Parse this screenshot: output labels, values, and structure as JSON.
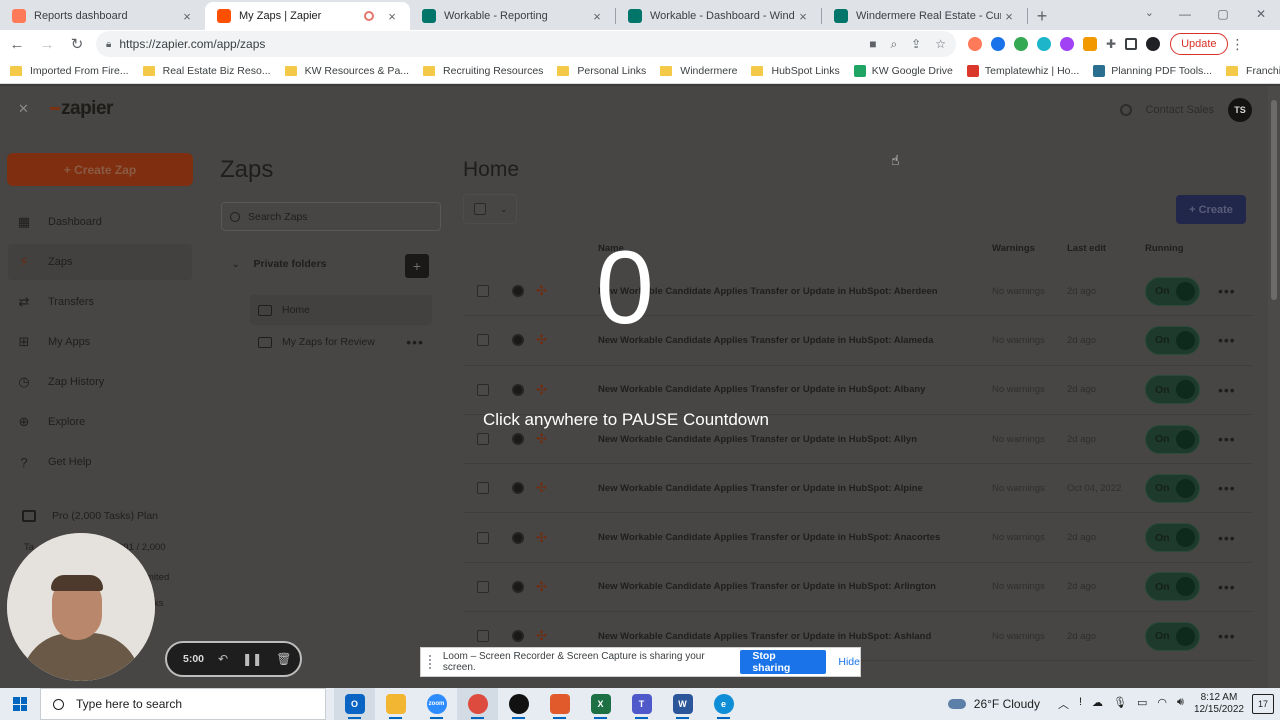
{
  "browser": {
    "tabs": [
      {
        "title": "Reports dashboard",
        "favicon_color": "#ff7a59",
        "active": false
      },
      {
        "title": "My Zaps | Zapier",
        "favicon_color": "#ff4f00",
        "active": true
      },
      {
        "title": "Workable - Reporting",
        "favicon_color": "#00756a",
        "active": false
      },
      {
        "title": "Workable - Dashboard - Windermere",
        "favicon_color": "#00756a",
        "active": false
      },
      {
        "title": "Windermere Real Estate - Current",
        "favicon_color": "#00756a",
        "active": false
      }
    ],
    "close_glyph": "×",
    "new_tab_glyph": "+",
    "url": "https://zapier.com/app/zaps",
    "update_label": "Update",
    "bookmarks": [
      {
        "label": "Imported From Fire...",
        "type": "folder"
      },
      {
        "label": "Real Estate Biz Reso...",
        "type": "folder"
      },
      {
        "label": "KW Resources & Pa...",
        "type": "folder"
      },
      {
        "label": "Recruiting Resources",
        "type": "folder"
      },
      {
        "label": "Personal Links",
        "type": "folder"
      },
      {
        "label": "Windermere",
        "type": "folder"
      },
      {
        "label": "HubSpot Links",
        "type": "folder"
      },
      {
        "label": "KW Google Drive",
        "type": "site",
        "color": "#1fa463"
      },
      {
        "label": "Templatewhiz | Ho...",
        "type": "site",
        "color": "#d9382b"
      },
      {
        "label": "Planning PDF Tools...",
        "type": "site",
        "color": "#2a6f8f"
      },
      {
        "label": "Franchise Info",
        "type": "folder"
      }
    ]
  },
  "zapier": {
    "logo_text": "zapier",
    "contact_sales": "Contact Sales",
    "avatar_initials": "TS",
    "create_zap_label": "+ Create Zap",
    "nav": [
      {
        "label": "Dashboard",
        "icon": "dashboard-icon",
        "glyph": "▦",
        "active": false
      },
      {
        "label": "Zaps",
        "icon": "zap-icon",
        "glyph": "⚡",
        "active": true
      },
      {
        "label": "Transfers",
        "icon": "transfers-icon",
        "glyph": "⇄",
        "active": false
      },
      {
        "label": "My Apps",
        "icon": "apps-icon",
        "glyph": "⊞",
        "active": false
      },
      {
        "label": "Zap History",
        "icon": "history-icon",
        "glyph": "◷",
        "active": false
      },
      {
        "label": "Explore",
        "icon": "globe-icon",
        "glyph": "⊕",
        "active": false
      },
      {
        "label": "Get Help",
        "icon": "help-icon",
        "glyph": "?",
        "active": false
      }
    ],
    "plan_label": "Pro (2,000 Tasks) Plan",
    "plan_tasks_prefix": "Ta",
    "plan_tasks_value": "391 / 2,000",
    "plan_line2": "mited",
    "plan_line3": "ks",
    "zaps_title": "Zaps",
    "search_placeholder": "Search Zaps",
    "private_folders": "Private folders",
    "folders": [
      {
        "label": "Home",
        "active": true
      },
      {
        "label": "My Zaps for Review",
        "active": false
      }
    ],
    "home_title": "Home",
    "create_label": "+ Create",
    "columns": {
      "name": "Name",
      "warnings": "Warnings",
      "last_edit": "Last edit",
      "running": "Running"
    },
    "zaps": [
      {
        "name": "New Workable Candidate Applies Transfer or Update in HubSpot: Aberdeen",
        "warnings": "No warnings",
        "last_edit": "2d ago",
        "status": "On"
      },
      {
        "name": "New Workable Candidate Applies Transfer or Update in HubSpot: Alameda",
        "warnings": "No warnings",
        "last_edit": "2d ago",
        "status": "On"
      },
      {
        "name": "New Workable Candidate Applies Transfer or Update in HubSpot: Albany",
        "warnings": "No warnings",
        "last_edit": "2d ago",
        "status": "On"
      },
      {
        "name": "New Workable Candidate Applies Transfer or Update in HubSpot: Allyn",
        "warnings": "No warnings",
        "last_edit": "2d ago",
        "status": "On"
      },
      {
        "name": "New Workable Candidate Applies Transfer or Update in HubSpot: Alpine",
        "warnings": "No warnings",
        "last_edit": "Oct 04, 2022",
        "status": "On"
      },
      {
        "name": "New Workable Candidate Applies Transfer or Update in HubSpot: Anacortes",
        "warnings": "No warnings",
        "last_edit": "2d ago",
        "status": "On"
      },
      {
        "name": "New Workable Candidate Applies Transfer or Update in HubSpot: Arlington",
        "warnings": "No warnings",
        "last_edit": "2d ago",
        "status": "On"
      },
      {
        "name": "New Workable Candidate Applies Transfer or Update in HubSpot: Ashland",
        "warnings": "No warnings",
        "last_edit": "2d ago",
        "status": "On"
      }
    ]
  },
  "loom": {
    "countdown": "0",
    "pause_text": "Click anywhere to PAUSE Countdown",
    "timer": "5:00",
    "share_message": "Loom – Screen Recorder & Screen Capture is sharing your screen.",
    "stop_sharing": "Stop sharing",
    "hide": "Hide"
  },
  "taskbar": {
    "search_placeholder": "Type here to search",
    "apps": [
      {
        "name": "outlook",
        "color": "#0a64c4",
        "glyph": "O"
      },
      {
        "name": "file-explorer",
        "color": "#f2b632",
        "glyph": ""
      },
      {
        "name": "zoom",
        "color": "#2d8cff",
        "glyph": "zoom"
      },
      {
        "name": "chrome",
        "color": "#dd4b3e",
        "glyph": ""
      },
      {
        "name": "app-5",
        "color": "#111111",
        "glyph": ""
      },
      {
        "name": "app-6",
        "color": "#e05a2b",
        "glyph": ""
      },
      {
        "name": "excel",
        "color": "#1d7044",
        "glyph": "X"
      },
      {
        "name": "teams",
        "color": "#5059c9",
        "glyph": "T"
      },
      {
        "name": "word",
        "color": "#2b579a",
        "glyph": "W"
      },
      {
        "name": "edge",
        "color": "#0f8dd6",
        "glyph": "e"
      }
    ],
    "weather": "26°F  Cloudy",
    "time": "8:12 AM",
    "date": "12/15/2022",
    "notifications": "17"
  }
}
